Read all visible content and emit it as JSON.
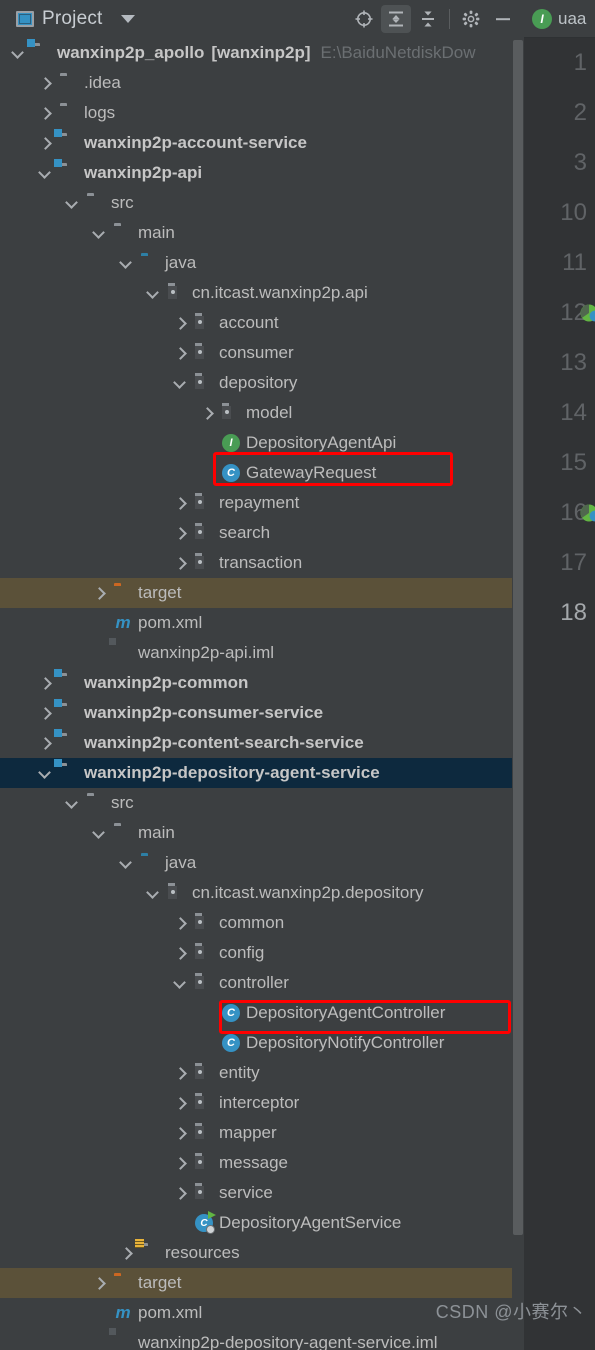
{
  "toolwindow": {
    "title": "Project",
    "icons": {
      "project": "project-window-icon",
      "dropdown": "chevron-down-icon",
      "locate": "locate-target-icon",
      "expand_all": "expand-all-icon",
      "collapse_all": "collapse-all-icon",
      "settings": "gear-icon",
      "hide": "minimize-icon"
    }
  },
  "editor": {
    "tab_label": "uaa",
    "tab_icon": "interface-icon",
    "tab_badge_letter": "I",
    "line_numbers": [
      "1",
      "2",
      "3",
      "10",
      "11",
      "12",
      "13",
      "14",
      "15",
      "16",
      "17",
      "18"
    ],
    "current_line": "18",
    "gutter_marks": [
      {
        "line": "12",
        "icon": "spring-bean-gutter-icon"
      },
      {
        "line": "16",
        "icon": "spring-bean-gutter-icon"
      }
    ]
  },
  "tree": {
    "rows": [
      {
        "indent": 0,
        "arrow": "down",
        "icon": "module-folder-icon",
        "label": "wanxinp2p_apollo",
        "bracket": "[wanxinp2p]",
        "hint": "E:\\BaiduNetdiskDow",
        "style": "bold"
      },
      {
        "indent": 1,
        "arrow": "right",
        "icon": "folder-icon",
        "label": ".idea",
        "style": "normal"
      },
      {
        "indent": 1,
        "arrow": "right",
        "icon": "folder-icon",
        "label": "logs",
        "style": "normal"
      },
      {
        "indent": 1,
        "arrow": "right",
        "icon": "module-folder-icon",
        "label": "wanxinp2p-account-service",
        "style": "bold"
      },
      {
        "indent": 1,
        "arrow": "down",
        "icon": "module-folder-icon",
        "label": "wanxinp2p-api",
        "style": "bold"
      },
      {
        "indent": 2,
        "arrow": "down",
        "icon": "folder-icon",
        "label": "src",
        "style": "normal"
      },
      {
        "indent": 3,
        "arrow": "down",
        "icon": "folder-icon",
        "label": "main",
        "style": "normal"
      },
      {
        "indent": 4,
        "arrow": "down",
        "icon": "source-root-folder-icon",
        "label": "java",
        "style": "normal"
      },
      {
        "indent": 5,
        "arrow": "down",
        "icon": "package-icon",
        "label": "cn.itcast.wanxinp2p.api",
        "style": "normal"
      },
      {
        "indent": 6,
        "arrow": "right",
        "icon": "package-icon",
        "label": "account",
        "style": "normal"
      },
      {
        "indent": 6,
        "arrow": "right",
        "icon": "package-icon",
        "label": "consumer",
        "style": "normal"
      },
      {
        "indent": 6,
        "arrow": "down",
        "icon": "package-icon",
        "label": "depository",
        "style": "normal"
      },
      {
        "indent": 7,
        "arrow": "right",
        "icon": "package-icon",
        "label": "model",
        "style": "normal"
      },
      {
        "indent": 7,
        "arrow": "none",
        "icon": "interface-icon",
        "label": "DepositoryAgentApi",
        "style": "normal"
      },
      {
        "indent": 7,
        "arrow": "none",
        "icon": "class-icon",
        "label": "GatewayRequest",
        "style": "normal"
      },
      {
        "indent": 6,
        "arrow": "right",
        "icon": "package-icon",
        "label": "repayment",
        "style": "normal"
      },
      {
        "indent": 6,
        "arrow": "right",
        "icon": "package-icon",
        "label": "search",
        "style": "normal"
      },
      {
        "indent": 6,
        "arrow": "right",
        "icon": "package-icon",
        "label": "transaction",
        "style": "normal"
      },
      {
        "indent": 3,
        "arrow": "right",
        "icon": "excluded-folder-icon",
        "label": "target",
        "style": "normal",
        "row_state": "excluded"
      },
      {
        "indent": 3,
        "arrow": "none",
        "icon": "maven-icon",
        "label": "pom.xml",
        "style": "normal"
      },
      {
        "indent": 3,
        "arrow": "none",
        "icon": "iml-file-icon",
        "label": "wanxinp2p-api.iml",
        "style": "normal"
      },
      {
        "indent": 1,
        "arrow": "right",
        "icon": "module-folder-icon",
        "label": "wanxinp2p-common",
        "style": "bold"
      },
      {
        "indent": 1,
        "arrow": "right",
        "icon": "module-folder-icon",
        "label": "wanxinp2p-consumer-service",
        "style": "bold"
      },
      {
        "indent": 1,
        "arrow": "right",
        "icon": "module-folder-icon",
        "label": "wanxinp2p-content-search-service",
        "style": "bold"
      },
      {
        "indent": 1,
        "arrow": "down",
        "icon": "module-folder-icon",
        "label": "wanxinp2p-depository-agent-service",
        "style": "bold",
        "row_state": "selected"
      },
      {
        "indent": 2,
        "arrow": "down",
        "icon": "folder-icon",
        "label": "src",
        "style": "normal"
      },
      {
        "indent": 3,
        "arrow": "down",
        "icon": "folder-icon",
        "label": "main",
        "style": "normal"
      },
      {
        "indent": 4,
        "arrow": "down",
        "icon": "source-root-folder-icon",
        "label": "java",
        "style": "normal"
      },
      {
        "indent": 5,
        "arrow": "down",
        "icon": "package-icon",
        "label": "cn.itcast.wanxinp2p.depository",
        "style": "normal"
      },
      {
        "indent": 6,
        "arrow": "right",
        "icon": "package-icon",
        "label": "common",
        "style": "normal"
      },
      {
        "indent": 6,
        "arrow": "right",
        "icon": "package-icon",
        "label": "config",
        "style": "normal"
      },
      {
        "indent": 6,
        "arrow": "down",
        "icon": "package-icon",
        "label": "controller",
        "style": "normal"
      },
      {
        "indent": 7,
        "arrow": "none",
        "icon": "class-icon",
        "label": "DepositoryAgentController",
        "style": "normal"
      },
      {
        "indent": 7,
        "arrow": "none",
        "icon": "class-icon",
        "label": "DepositoryNotifyController",
        "style": "normal"
      },
      {
        "indent": 6,
        "arrow": "right",
        "icon": "package-icon",
        "label": "entity",
        "style": "normal"
      },
      {
        "indent": 6,
        "arrow": "right",
        "icon": "package-icon",
        "label": "interceptor",
        "style": "normal"
      },
      {
        "indent": 6,
        "arrow": "right",
        "icon": "package-icon",
        "label": "mapper",
        "style": "normal"
      },
      {
        "indent": 6,
        "arrow": "right",
        "icon": "package-icon",
        "label": "message",
        "style": "normal"
      },
      {
        "indent": 6,
        "arrow": "right",
        "icon": "package-icon",
        "label": "service",
        "style": "normal"
      },
      {
        "indent": 6,
        "arrow": "none",
        "icon": "spring-bean-icon",
        "label": "DepositoryAgentService",
        "style": "normal"
      },
      {
        "indent": 4,
        "arrow": "right",
        "icon": "resources-folder-icon",
        "label": "resources",
        "style": "normal"
      },
      {
        "indent": 3,
        "arrow": "right",
        "icon": "excluded-folder-icon",
        "label": "target",
        "style": "normal",
        "row_state": "excluded"
      },
      {
        "indent": 3,
        "arrow": "none",
        "icon": "maven-icon",
        "label": "pom.xml",
        "style": "normal"
      },
      {
        "indent": 3,
        "arrow": "none",
        "icon": "iml-file-icon",
        "label": "wanxinp2p-depository-agent-service.iml",
        "style": "normal"
      }
    ]
  },
  "annotations": [
    {
      "name": "highlight-depository-agent-api",
      "color": "#ff0000"
    },
    {
      "name": "highlight-depository-agent-controller",
      "color": "#ff0000"
    }
  ],
  "watermark": {
    "text": "CSDN @小赛尔丶"
  },
  "colors": {
    "panel_bg": "#3c3f41",
    "editor_bg": "#313335",
    "selection": "#0d293e",
    "excluded_row": "#5b5139",
    "accent_blue": "#3592c4",
    "accent_green": "#499c54",
    "excluded_orange": "#cc6722",
    "text": "#bbbbbb",
    "annotation_red": "#ff0000"
  }
}
